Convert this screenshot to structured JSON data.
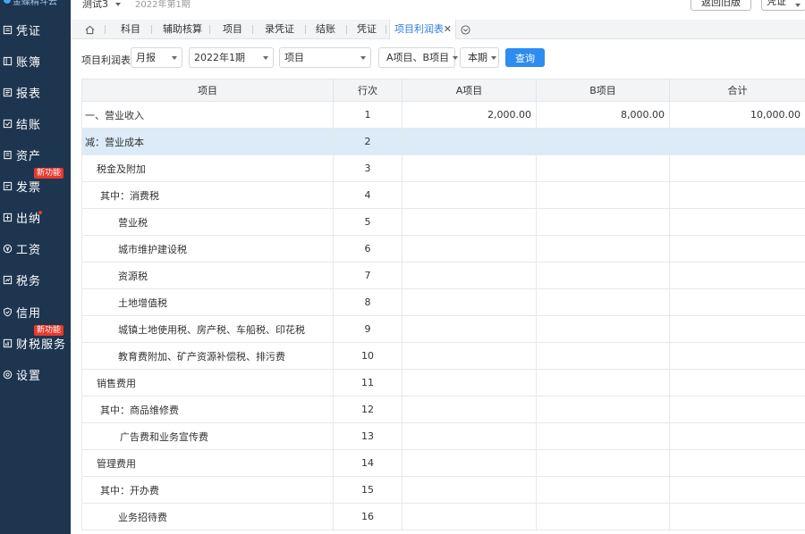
{
  "app": {
    "logo_text": "金蝶精斗云"
  },
  "account": {
    "name": "测试3",
    "period": "2022年第1期"
  },
  "top_buttons": {
    "old_version": "返回旧版",
    "voucher_select": "凭证"
  },
  "sidebar": {
    "items": [
      {
        "label": "凭证",
        "icon": "voucher-icon"
      },
      {
        "label": "账簿",
        "icon": "ledger-icon"
      },
      {
        "label": "报表",
        "icon": "report-icon"
      },
      {
        "label": "结账",
        "icon": "closing-icon"
      },
      {
        "label": "资产",
        "icon": "asset-icon"
      },
      {
        "label": "发票",
        "icon": "invoice-icon",
        "badge": "新功能"
      },
      {
        "label": "出纳",
        "icon": "cashier-icon"
      },
      {
        "label": "工资",
        "icon": "salary-icon"
      },
      {
        "label": "税务",
        "icon": "tax-icon"
      },
      {
        "label": "信用",
        "icon": "credit-icon"
      },
      {
        "label": "财税服务",
        "icon": "finance-service-icon",
        "badge": "新功能"
      },
      {
        "label": "设置",
        "icon": "settings-icon"
      }
    ]
  },
  "tabs": [
    {
      "label": "科目"
    },
    {
      "label": "辅助核算"
    },
    {
      "label": "项目"
    },
    {
      "label": "录凭证"
    },
    {
      "label": "结账"
    },
    {
      "label": "凭证"
    },
    {
      "label": "项目利润表",
      "active": true
    }
  ],
  "filters": {
    "report_label": "项目利润表",
    "period_type": "月报",
    "period": "2022年1期",
    "dimension": "项目",
    "projects": "A项目、B项目",
    "scope": "本期",
    "query_button": "查询"
  },
  "table": {
    "columns": [
      "项目",
      "行次",
      "A项目",
      "B项目",
      "合计"
    ],
    "rows": [
      {
        "name": "一、营业收入",
        "no": "1",
        "a": "2,000.00",
        "b": "8,000.00",
        "total": "10,000.00",
        "indent": 0
      },
      {
        "name": "减：营业成本",
        "no": "2",
        "a": "",
        "b": "",
        "total": "",
        "indent": 0,
        "highlight": true
      },
      {
        "name": "税金及附加",
        "no": "3",
        "a": "",
        "b": "",
        "total": "",
        "indent": 1
      },
      {
        "name": "其中：消费税",
        "no": "4",
        "a": "",
        "b": "",
        "total": "",
        "indent": 2
      },
      {
        "name": "营业税",
        "no": "5",
        "a": "",
        "b": "",
        "total": "",
        "indent": 3
      },
      {
        "name": "城市维护建设税",
        "no": "6",
        "a": "",
        "b": "",
        "total": "",
        "indent": 3
      },
      {
        "name": "资源税",
        "no": "7",
        "a": "",
        "b": "",
        "total": "",
        "indent": 3
      },
      {
        "name": "土地增值税",
        "no": "8",
        "a": "",
        "b": "",
        "total": "",
        "indent": 3
      },
      {
        "name": "城镇土地使用税、房产税、车船税、印花税",
        "no": "9",
        "a": "",
        "b": "",
        "total": "",
        "indent": 3
      },
      {
        "name": "教育费附加、矿产资源补偿税、排污费",
        "no": "10",
        "a": "",
        "b": "",
        "total": "",
        "indent": 3
      },
      {
        "name": "销售费用",
        "no": "11",
        "a": "",
        "b": "",
        "total": "",
        "indent": 1
      },
      {
        "name": "其中：商品维修费",
        "no": "12",
        "a": "",
        "b": "",
        "total": "",
        "indent": 2
      },
      {
        "name": "广告费和业务宣传费",
        "no": "13",
        "a": "",
        "b": "",
        "total": "",
        "indent": 4
      },
      {
        "name": "管理费用",
        "no": "14",
        "a": "",
        "b": "",
        "total": "",
        "indent": 1
      },
      {
        "name": "其中：开办费",
        "no": "15",
        "a": "",
        "b": "",
        "total": "",
        "indent": 2
      },
      {
        "name": "业务招待费",
        "no": "16",
        "a": "",
        "b": "",
        "total": "",
        "indent": 3
      }
    ]
  }
}
